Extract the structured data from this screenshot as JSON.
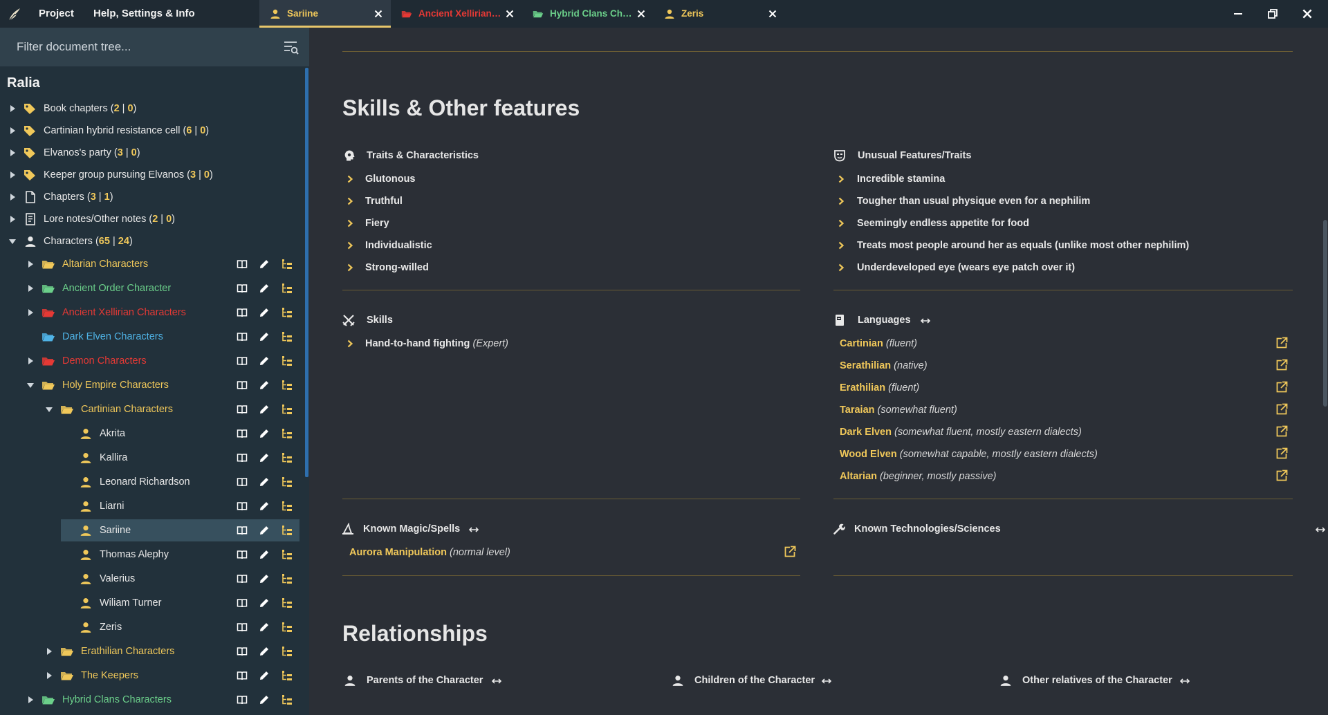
{
  "titlebar": {
    "menu_project": "Project",
    "menu_help": "Help, Settings & Info",
    "tabs": [
      {
        "label": "Sariine",
        "color": "#f0c85a",
        "icon": "person-icon"
      },
      {
        "label": "Ancient Xellirian C...",
        "color": "#e53935",
        "icon": "folder-icon"
      },
      {
        "label": "Hybrid Clans Char...",
        "color": "#6bcf8a",
        "icon": "folder-icon"
      },
      {
        "label": "Zeris",
        "color": "#f0c85a",
        "icon": "person-icon"
      }
    ]
  },
  "sidebar": {
    "filter_placeholder": "Filter document tree...",
    "project_title": "Ralia",
    "top_items": [
      {
        "label": "Book chapters",
        "a": "2",
        "b": "0",
        "icon": "tag-icon"
      },
      {
        "label": "Cartinian hybrid resistance cell",
        "a": "6",
        "b": "0",
        "icon": "tag-icon"
      },
      {
        "label": "Elvanos's party",
        "a": "3",
        "b": "0",
        "icon": "tag-icon"
      },
      {
        "label": "Keeper group pursuing Elvanos",
        "a": "3",
        "b": "0",
        "icon": "tag-icon"
      },
      {
        "label": "Chapters",
        "a": "3",
        "b": "1",
        "icon": "document-icon"
      },
      {
        "label": "Lore notes/Other notes",
        "a": "2",
        "b": "0",
        "icon": "notes-icon"
      },
      {
        "label": "Characters",
        "a": "65",
        "b": "24",
        "icon": "person-icon"
      }
    ],
    "count_open": " (",
    "count_sep": " | ",
    "count_close": ")",
    "tree": [
      {
        "label": "Altarian Characters",
        "color": "#f0c85a"
      },
      {
        "label": "Ancient Order Character",
        "color": "#6bcf8a"
      },
      {
        "label": "Ancient Xellirian Characters",
        "color": "#e53935"
      },
      {
        "label": "Dark Elven Characters",
        "color": "#4fb3e6"
      },
      {
        "label": "Demon Characters",
        "color": "#e53935"
      },
      {
        "label": "Holy Empire Characters",
        "color": "#f0c85a"
      },
      {
        "label": "Cartinian Characters",
        "color": "#f0c85a"
      },
      {
        "label": "Akrita",
        "color": "#e8e8e8"
      },
      {
        "label": "Kallira",
        "color": "#e8e8e8"
      },
      {
        "label": "Leonard Richardson",
        "color": "#e8e8e8"
      },
      {
        "label": "Liarni",
        "color": "#e8e8e8"
      },
      {
        "label": "Sariine",
        "color": "#e8e8e8"
      },
      {
        "label": "Thomas Alephy",
        "color": "#e8e8e8"
      },
      {
        "label": "Valerius",
        "color": "#e8e8e8"
      },
      {
        "label": "Wiliam Turner",
        "color": "#e8e8e8"
      },
      {
        "label": "Zeris",
        "color": "#e8e8e8"
      },
      {
        "label": "Erathilian Characters",
        "color": "#f0c85a"
      },
      {
        "label": "The Keepers",
        "color": "#f0c85a"
      },
      {
        "label": "Hybrid Clans Characters",
        "color": "#6bcf8a"
      }
    ]
  },
  "main": {
    "skills_section_title": "Skills & Other features",
    "traits": {
      "title": "Traits & Characteristics",
      "items": [
        "Glutonous",
        "Truthful",
        "Fiery",
        "Individualistic",
        "Strong-willed"
      ]
    },
    "unusual": {
      "title": "Unusual Features/Traits",
      "items": [
        "Incredible stamina",
        "Tougher than usual physique even for a nephilim",
        "Seemingly endless appetite for food",
        "Treats most people around her as equals (unlike most other nephilim)",
        "Underdeveloped eye (wears eye patch over it)"
      ]
    },
    "skills": {
      "title": "Skills",
      "items": [
        {
          "name": "Hand-to-hand fighting",
          "level": "(Expert)"
        }
      ]
    },
    "languages": {
      "title": "Languages",
      "items": [
        {
          "name": "Cartinian",
          "level": "(fluent)"
        },
        {
          "name": "Serathilian",
          "level": "(native)"
        },
        {
          "name": "Erathilian",
          "level": "(fluent)"
        },
        {
          "name": "Taraian",
          "level": "(somewhat fluent)"
        },
        {
          "name": "Dark Elven",
          "level": "(somewhat fluent, mostly eastern dialects)"
        },
        {
          "name": "Wood Elven",
          "level": "(somewhat capable, mostly eastern dialects)"
        },
        {
          "name": "Altarian",
          "level": "(beginner, mostly passive)"
        }
      ]
    },
    "magic": {
      "title": "Known Magic/Spells",
      "items": [
        {
          "name": "Aurora Manipulation",
          "level": "(normal level)"
        }
      ]
    },
    "tech": {
      "title": "Known Technologies/Sciences"
    },
    "relationships_title": "Relationships",
    "parents_title": "Parents of the Character",
    "children_title": "Children of the Character",
    "relatives_title": "Other relatives of the Character"
  },
  "colors": {
    "accent_gold": "#f0c85a",
    "green": "#6bcf8a",
    "red": "#e53935",
    "blue": "#4fb3e6",
    "sidebar_bg": "#22313b",
    "main_bg": "#2b2f36"
  }
}
